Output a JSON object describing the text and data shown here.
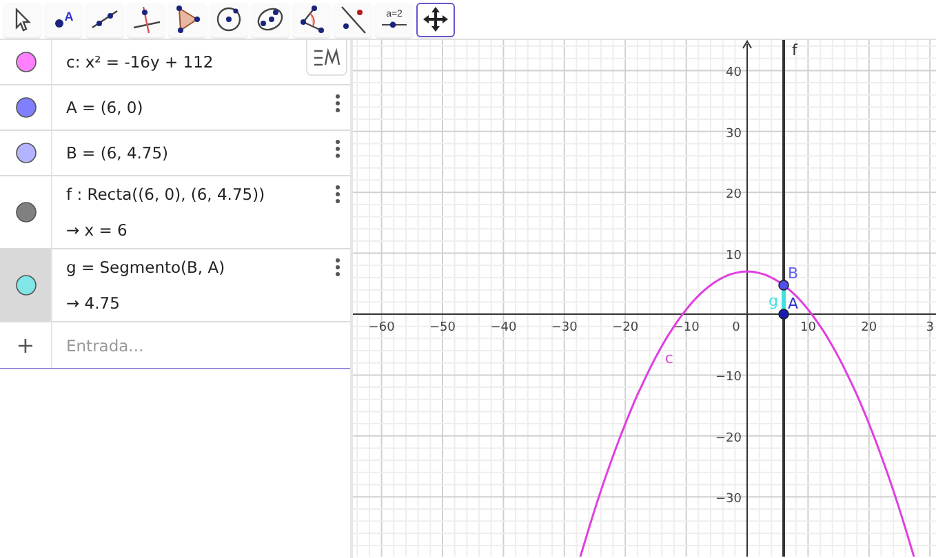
{
  "toolbar": {
    "tools": [
      {
        "kind": "move",
        "selected": false
      },
      {
        "kind": "point",
        "label": "A",
        "selected": false
      },
      {
        "kind": "line",
        "selected": false
      },
      {
        "kind": "perpendicular",
        "selected": false
      },
      {
        "kind": "polygon",
        "selected": false
      },
      {
        "kind": "circle",
        "selected": false
      },
      {
        "kind": "conic",
        "selected": false
      },
      {
        "kind": "angle",
        "selected": false
      },
      {
        "kind": "reflect",
        "selected": false
      },
      {
        "kind": "slider",
        "label": "a=2",
        "selected": false
      },
      {
        "kind": "pan",
        "selected": true
      }
    ]
  },
  "algebra": {
    "rows": [
      {
        "color": "#ff80ff",
        "definition": "c: x² = -16y + 112",
        "selected": false,
        "style_button": true
      },
      {
        "color": "#8080ff",
        "definition": "A = (6, 0)",
        "selected": false
      },
      {
        "color": "#b3b3ff",
        "definition": "B = (6, 4.75)",
        "selected": false
      },
      {
        "color": "#808080",
        "definition": "f : Recta((6, 0), (6, 4.75))",
        "output": "→  x = 6",
        "selected": false
      },
      {
        "color": "#80e6e6",
        "definition": "g = Segmento(B, A)",
        "output": "→  4.75",
        "selected": true
      }
    ],
    "input": {
      "plus": "+",
      "placeholder": "Entrada..."
    }
  },
  "graphics": {
    "x_tick_labels": [
      "−60",
      "−50",
      "−40",
      "−30",
      "−20",
      "−10",
      "0",
      "10",
      "20",
      "3"
    ],
    "y_tick_labels": [
      "40",
      "30",
      "20",
      "10",
      "−10",
      "−20",
      "−30"
    ],
    "object_labels": {
      "c": "c",
      "f": "f",
      "g": "g",
      "A": "A",
      "B": "B"
    }
  }
}
